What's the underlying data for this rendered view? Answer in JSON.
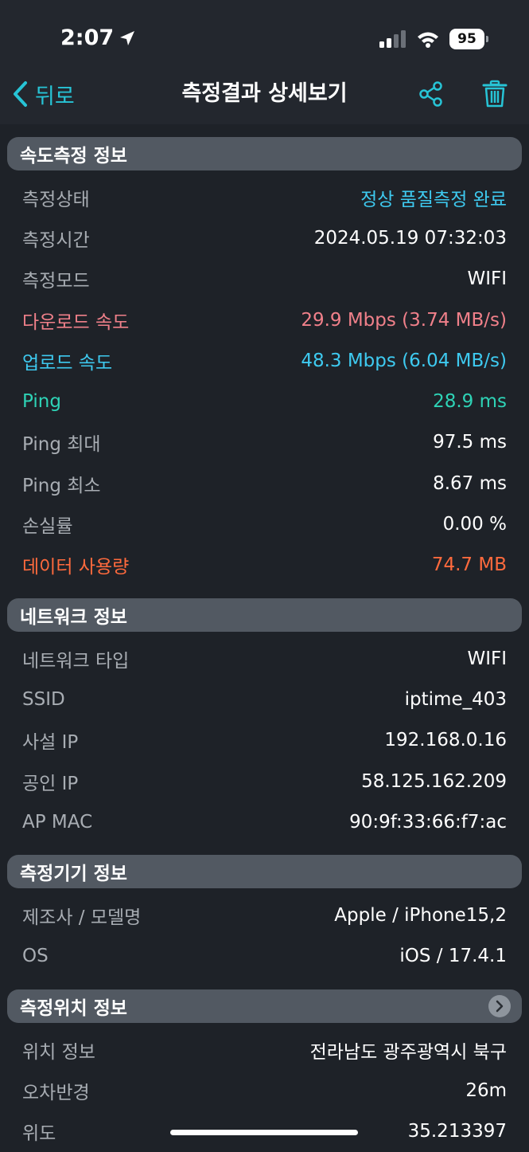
{
  "status_bar": {
    "time": "2:07",
    "battery": "95"
  },
  "nav": {
    "back_label": "뒤로",
    "title": "측정결과 상세보기"
  },
  "colors": {
    "accent": "#27c4d6",
    "download": "#f0808a",
    "upload": "#3ecaf0",
    "ping": "#2ed3b6",
    "data_usage": "#ff6a3d"
  },
  "sections": {
    "speed": {
      "title": "속도측정 정보",
      "rows": [
        {
          "label": "측정상태",
          "value": "정상 품질측정 완료"
        },
        {
          "label": "측정시간",
          "value": "2024.05.19 07:32:03"
        },
        {
          "label": "측정모드",
          "value": "WIFI"
        },
        {
          "label": "다운로드 속도",
          "value": "29.9 Mbps (3.74 MB/s)"
        },
        {
          "label": "업로드 속도",
          "value": "48.3 Mbps (6.04 MB/s)"
        },
        {
          "label": "Ping",
          "value": "28.9 ms"
        },
        {
          "label": "Ping 최대",
          "value": "97.5 ms"
        },
        {
          "label": "Ping 최소",
          "value": "8.67 ms"
        },
        {
          "label": "손실률",
          "value": "0.00 %"
        },
        {
          "label": "데이터 사용량",
          "value": "74.7 MB"
        }
      ]
    },
    "network": {
      "title": "네트워크 정보",
      "rows": [
        {
          "label": "네트워크 타입",
          "value": "WIFI"
        },
        {
          "label": "SSID",
          "value": "iptime_403"
        },
        {
          "label": "사설 IP",
          "value": "192.168.0.16"
        },
        {
          "label": "공인 IP",
          "value": "58.125.162.209"
        },
        {
          "label": "AP MAC",
          "value": "90:9f:33:66:f7:ac"
        }
      ]
    },
    "device": {
      "title": "측정기기 정보",
      "rows": [
        {
          "label": "제조사 / 모델명",
          "value": "Apple / iPhone15,2"
        },
        {
          "label": "OS",
          "value": "iOS / 17.4.1"
        }
      ]
    },
    "location": {
      "title": "측정위치 정보",
      "rows": [
        {
          "label": "위치 정보",
          "value": "전라남도 광주광역시 북구"
        },
        {
          "label": "오차반경",
          "value": "26m"
        },
        {
          "label": "위도",
          "value": "35.213397"
        }
      ]
    }
  }
}
